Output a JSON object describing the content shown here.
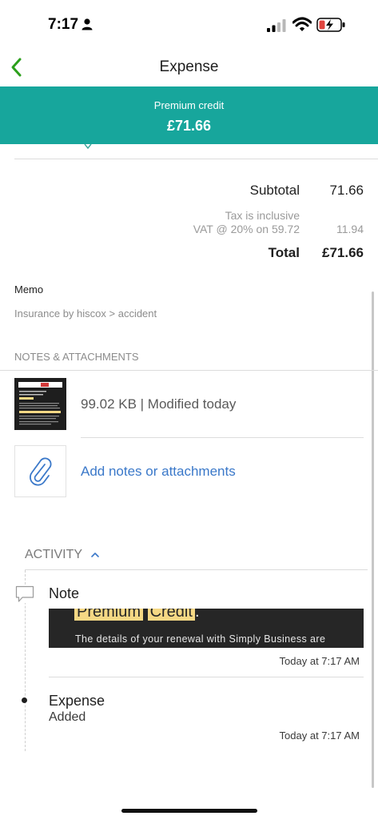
{
  "status_bar": {
    "time": "7:17"
  },
  "nav": {
    "title": "Expense"
  },
  "banner": {
    "label": "Premium credit",
    "amount": "£71.66"
  },
  "totals": {
    "subtotal_label": "Subtotal",
    "subtotal_value": "71.66",
    "tax_note": "Tax is inclusive",
    "vat_label": "VAT @ 20% on 59.72",
    "vat_value": "11.94",
    "total_label": "Total",
    "total_value": "£71.66"
  },
  "memo": {
    "label": "Memo",
    "value": "Insurance by hiscox > accident"
  },
  "notes_attachments": {
    "header": "NOTES & ATTACHMENTS",
    "attachment_meta": "99.02 KB | Modified today",
    "add_label": "Add notes or attachments"
  },
  "activity": {
    "header": "ACTIVITY",
    "note": {
      "title": "Note",
      "preview_word1": "Premium",
      "preview_word2": "Credit",
      "preview_punct": ".",
      "preview_body": "The details of your renewal with Simply Business are",
      "timestamp": "Today at 7:17 AM"
    },
    "expense": {
      "title": "Expense",
      "subtitle": "Added",
      "timestamp": "Today at 7:17 AM"
    }
  },
  "colors": {
    "banner": "#17a69c",
    "back_icon": "#2ca01c",
    "link": "#3a78c9"
  }
}
